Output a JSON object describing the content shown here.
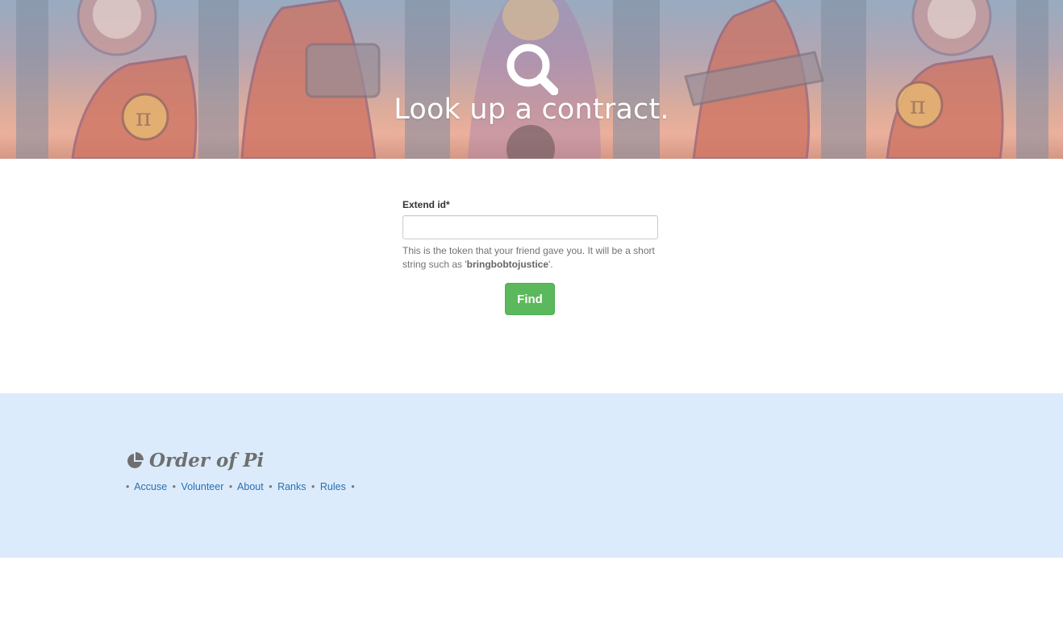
{
  "hero": {
    "title": "Look up a contract.",
    "icon": "search-icon"
  },
  "form": {
    "field_label": "Extend id*",
    "input_value": "",
    "input_placeholder": "",
    "help_prefix": "This is the token that your friend gave you. It will be a short string such as '",
    "help_example": "bringbobtojustice",
    "help_suffix": "'.",
    "submit_label": "Find"
  },
  "footer": {
    "brand_icon": "pie-chart-icon",
    "brand_name": "Order of Pi",
    "separator": "•",
    "links": [
      {
        "label": "Accuse"
      },
      {
        "label": "Volunteer"
      },
      {
        "label": "About"
      },
      {
        "label": "Ranks"
      },
      {
        "label": "Rules"
      }
    ]
  },
  "colors": {
    "accent_button": "#5cb85c",
    "footer_background": "#dcebfb",
    "link": "#2a6fb0"
  }
}
